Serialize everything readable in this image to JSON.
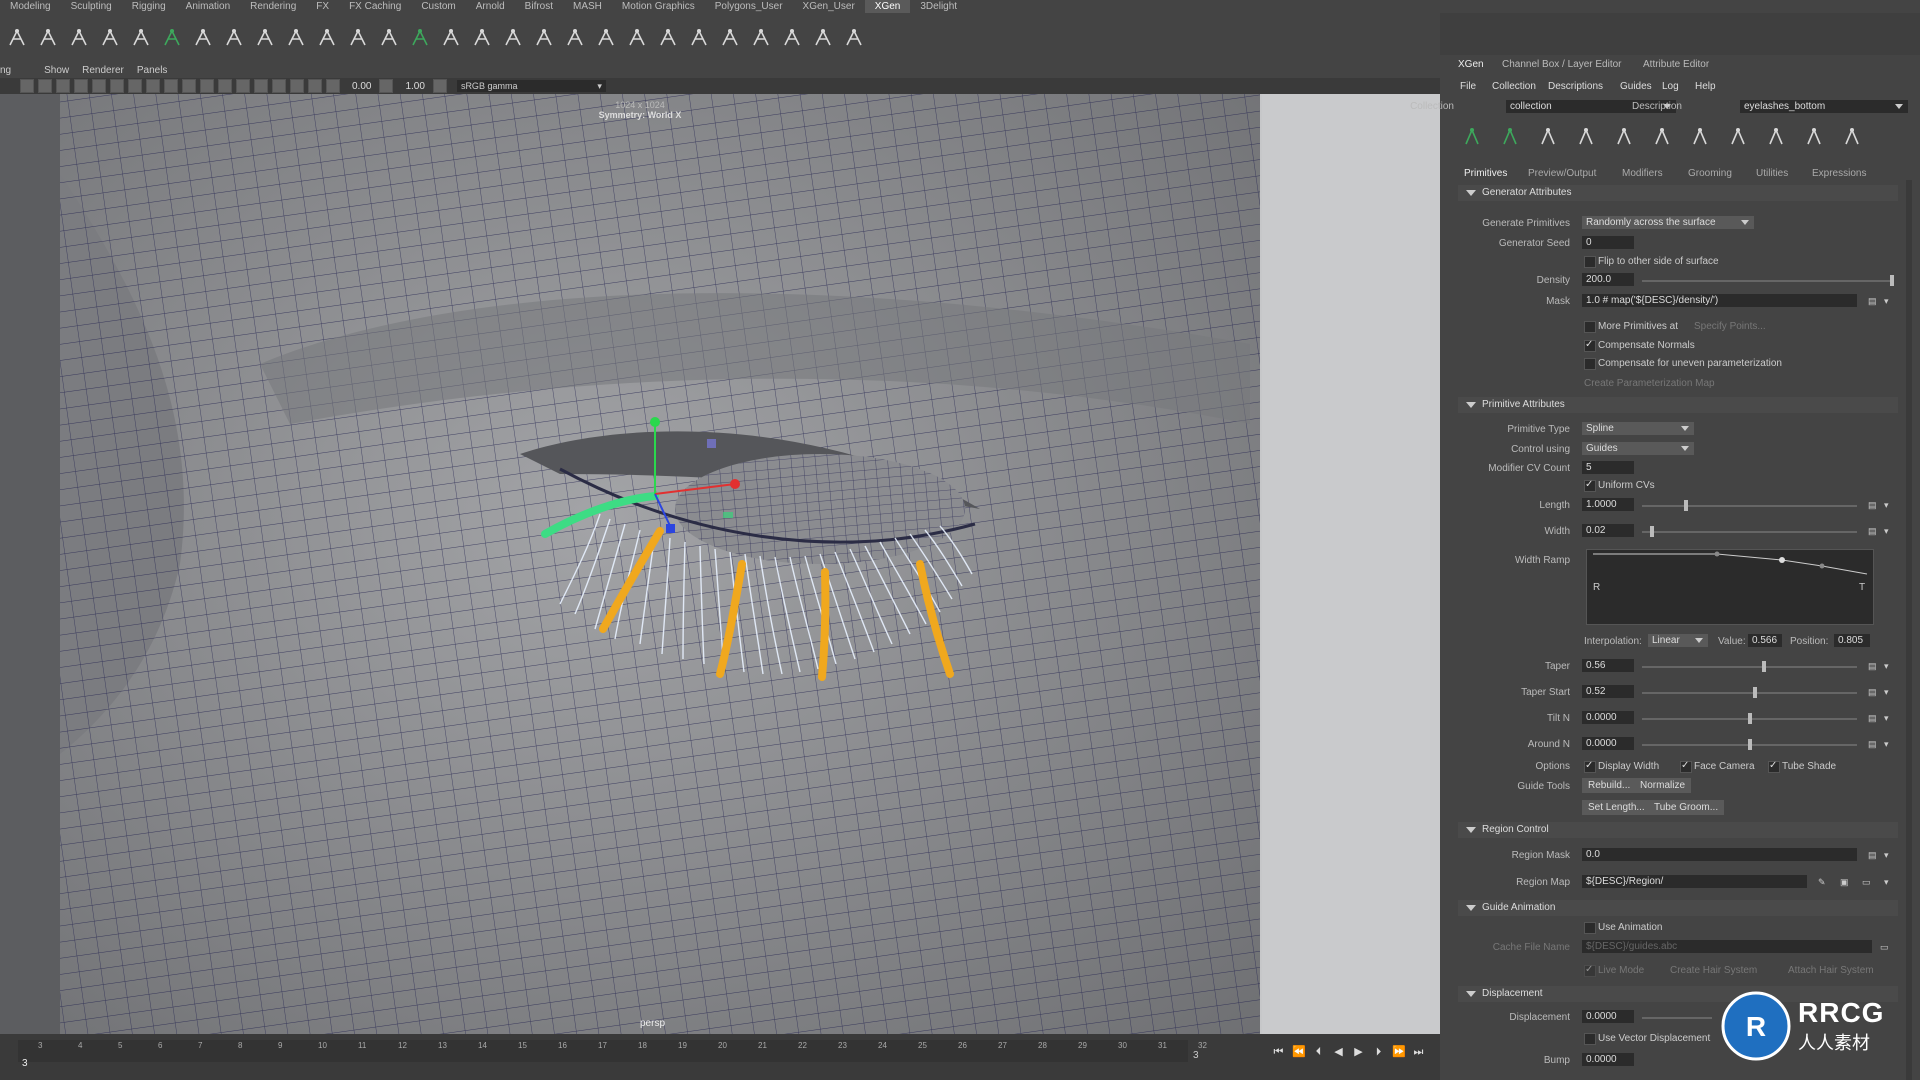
{
  "shelf_tabs": [
    "Modeling",
    "Sculpting",
    "Rigging",
    "Animation",
    "Rendering",
    "FX",
    "FX Caching",
    "Custom",
    "Arnold",
    "Bifrost",
    "MASH",
    "Motion Graphics",
    "Polygons_User",
    "XGen_User",
    "XGen",
    "3Delight"
  ],
  "shelf_tab_active": "XGen",
  "viewport": {
    "menu": [
      "ng",
      "Show",
      "Renderer",
      "Panels"
    ],
    "field_a": "0.00",
    "field_b": "1.00",
    "color_space": "sRGB gamma",
    "resolution": "1024 x 1024",
    "symmetry": "Symmetry: World X",
    "camera": "persp"
  },
  "timeline": {
    "ticks": [
      "3",
      "4",
      "5",
      "6",
      "7",
      "8",
      "9",
      "10",
      "11",
      "12",
      "13",
      "14",
      "15",
      "16",
      "17",
      "18",
      "19",
      "20",
      "21",
      "22",
      "23",
      "24",
      "25",
      "26",
      "27",
      "28",
      "29",
      "30",
      "31",
      "32"
    ],
    "current_frame": "3",
    "end_frame": "3"
  },
  "panel": {
    "tabs": [
      "XGen",
      "Channel Box / Layer Editor",
      "Attribute Editor"
    ],
    "menu": [
      "File",
      "Collection",
      "Descriptions",
      "Guides",
      "Log",
      "Help"
    ],
    "collection_label": "Collection",
    "collection_value": "collection",
    "description_label": "Description",
    "description_value": "eyelashes_bottom",
    "subtabs": [
      "Primitives",
      "Preview/Output",
      "Modifiers",
      "Grooming",
      "Utilities",
      "Expressions"
    ],
    "generator": {
      "header": "Generator Attributes",
      "generate_primitives_label": "Generate Primitives",
      "generate_primitives_value": "Randomly across the surface",
      "seed_label": "Generator Seed",
      "seed_value": "0",
      "flip_label": "Flip to other side of surface",
      "density_label": "Density",
      "density_value": "200.0",
      "mask_label": "Mask",
      "mask_value": "1.0 # map('${DESC}/density/')",
      "more_primitives_label": "More Primitives at",
      "specify_points_label": "Specify Points...",
      "compensate_normals_label": "Compensate Normals",
      "compensate_uneven_label": "Compensate for uneven parameterization",
      "create_param_map_label": "Create Parameterization Map"
    },
    "primitive": {
      "header": "Primitive Attributes",
      "type_label": "Primitive Type",
      "type_value": "Spline",
      "control_label": "Control using",
      "control_value": "Guides",
      "cv_count_label": "Modifier CV Count",
      "cv_count_value": "5",
      "uniform_cvs_label": "Uniform CVs",
      "length_label": "Length",
      "length_value": "1.0000",
      "width_label": "Width",
      "width_value": "0.02",
      "width_ramp_label": "Width Ramp",
      "ramp_left": "R",
      "ramp_right": "T",
      "interpolation_label": "Interpolation:",
      "interpolation_value": "Linear",
      "value_label": "Value:",
      "value_value": "0.566",
      "position_label": "Position:",
      "position_value": "0.805",
      "taper_label": "Taper",
      "taper_value": "0.56",
      "taper_start_label": "Taper Start",
      "taper_start_value": "0.52",
      "tilt_n_label": "Tilt N",
      "tilt_n_value": "0.0000",
      "around_n_label": "Around N",
      "around_n_value": "0.0000",
      "options_label": "Options",
      "display_width_label": "Display Width",
      "face_camera_label": "Face Camera",
      "tube_shade_label": "Tube Shade",
      "guide_tools_label": "Guide Tools",
      "rebuild_label": "Rebuild...",
      "normalize_label": "Normalize",
      "set_length_label": "Set Length...",
      "tube_groom_label": "Tube Groom..."
    },
    "region": {
      "header": "Region Control",
      "mask_label": "Region Mask",
      "mask_value": "0.0",
      "map_label": "Region Map",
      "map_value": "${DESC}/Region/"
    },
    "guide_anim": {
      "header": "Guide Animation",
      "use_anim_label": "Use Animation",
      "cache_label": "Cache File Name",
      "cache_value": "${DESC}/guides.abc",
      "live_mode_label": "Live Mode",
      "create_hair_label": "Create Hair System",
      "attach_hair_label": "Attach Hair System"
    },
    "displacement": {
      "header": "Displacement",
      "disp_label": "Displacement",
      "disp_value": "0.0000",
      "use_vector_label": "Use Vector Displacement",
      "bump_label": "Bump",
      "bump_value": "0.0000"
    }
  },
  "watermark": {
    "text1": "RRCG",
    "text2": "人人素材"
  },
  "colors": {
    "guide_orange": "#f0a81e",
    "guide_selected": "#3ddc84",
    "mesh_wire": "#23234f",
    "mesh_fill": "#8e8f92"
  }
}
